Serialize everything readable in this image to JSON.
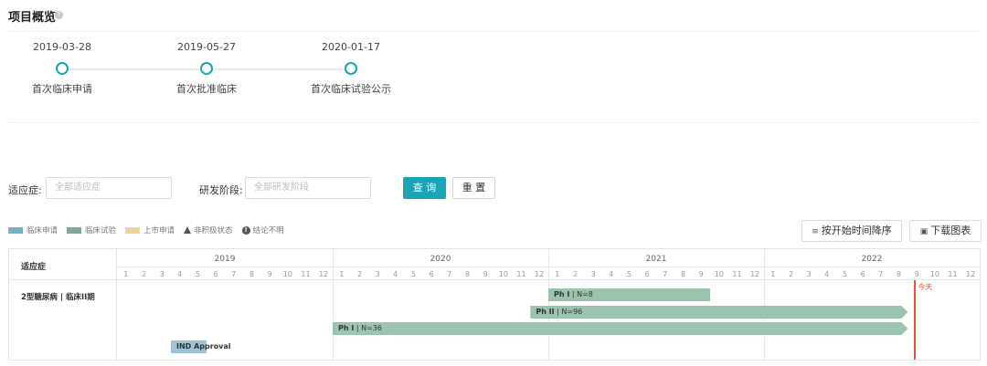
{
  "page": {
    "title": "项目概览",
    "help_icon": "help-icon"
  },
  "timeline": {
    "milestones": [
      {
        "date": "2019-03-28",
        "label": "首次临床申请"
      },
      {
        "date": "2019-05-27",
        "label": "首次批准临床"
      },
      {
        "date": "2020-01-17",
        "label": "首次临床试验公示"
      }
    ],
    "accent_color": "#1aa4b6"
  },
  "filters": {
    "indication": {
      "label": "适应症:",
      "placeholder": "全部适应症"
    },
    "stage": {
      "label": "研发阶段:",
      "placeholder": "全部研发阶段"
    },
    "search_label": "查 询",
    "reset_label": "重 置"
  },
  "legend": [
    {
      "label": "临床申请",
      "color": "#7aaec6"
    },
    {
      "label": "临床试验",
      "color": "#7ea993"
    },
    {
      "label": "上市申请",
      "color": "#f0cfa2"
    },
    {
      "label": "非积极状态",
      "icon": "triangle-icon"
    },
    {
      "label": "结论不明",
      "icon": "exclamation-icon"
    }
  ],
  "actions": {
    "sort_label": "按开始时间降序",
    "download_label": "下载图表"
  },
  "gantt": {
    "column_header": "适应症",
    "row_label": "2型糖尿病 | 临床II期",
    "years": [
      "2019",
      "2020",
      "2021",
      "2022"
    ],
    "months": [
      "1",
      "2",
      "3",
      "4",
      "5",
      "6",
      "7",
      "8",
      "9",
      "10",
      "11",
      "12"
    ],
    "today_label": "今天",
    "bars": [
      {
        "phase": "Ph I",
        "n": "N=8",
        "start": "2021-01",
        "end": "2021-09",
        "color": "#9cc3ad",
        "arrow": false
      },
      {
        "phase": "Ph II",
        "n": "N=96",
        "start": "2020-12",
        "end": "2022-09",
        "color": "#9cc3ad",
        "arrow": true
      },
      {
        "phase": "Ph I",
        "n": "N=36",
        "start": "2020-01",
        "end": "2022-09",
        "color": "#9cc3ad",
        "arrow": true
      },
      {
        "phase": "IND Approval",
        "n": "",
        "start": "2019-04",
        "end": "2019-05",
        "color": "#9cc6d8",
        "arrow": false
      }
    ],
    "today_color": "#e8562e"
  }
}
